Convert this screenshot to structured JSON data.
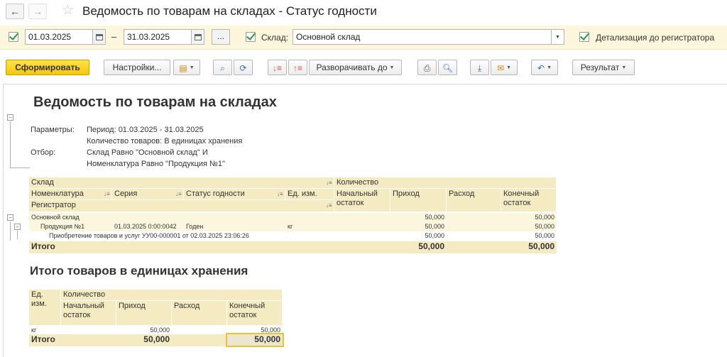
{
  "window": {
    "title": "Ведомость по товарам на складах - Статус годности",
    "back_glyph": "←",
    "forward_glyph": "→",
    "star_glyph": "☆"
  },
  "filter": {
    "date_from": "01.03.2025",
    "date_separator": "–",
    "date_to": "31.03.2025",
    "dots_label": "...",
    "warehouse_label": "Склад:",
    "warehouse_value": "Основной склад",
    "detail_label": "Детализация до регистратора",
    "dropdown_glyph": "▼"
  },
  "toolbar": {
    "generate_label": "Сформировать",
    "settings_label": "Настройки...",
    "expand_label": "Разворачивать до",
    "result_label": "Результат",
    "caret_glyph": "▼",
    "icons": [
      "save-variant-icon",
      "search-icon",
      "search-next-icon",
      "sort-asc-icon",
      "sort-desc-icon",
      "print-icon",
      "preview-icon",
      "download-icon",
      "mail-icon",
      "undo-icon"
    ]
  },
  "report": {
    "title": "Ведомость по товарам на складах",
    "params_label": "Параметры:",
    "params_line1": "Период: 01.03.2025 - 31.03.2025",
    "params_line2": "Количество товаров: В единицах хранения",
    "filter_label": "Отбор:",
    "filter_line1": "Склад Равно \"Основной склад\" И",
    "filter_line2": "Номенклатура Равно \"Продукция №1\"",
    "gutter_glyph": "−",
    "sort_glyph": "↓≡",
    "table1": {
      "h_warehouse": "Склад",
      "h_quantity": "Количество",
      "h_nomenclature": "Номенклатура",
      "h_series": "Серия",
      "h_status": "Статус годности",
      "h_unit": "Ед. изм.",
      "h_start_1": "Начальный",
      "h_start_2": "остаток",
      "h_income": "Приход",
      "h_outcome": "Расход",
      "h_end_1": "Конечный",
      "h_end_2": "остаток",
      "h_registrar": "Регистратор",
      "row_warehouse": {
        "name": "Основной склад",
        "income": "50,000",
        "end": "50,000"
      },
      "row_product": {
        "name": "Продукция №1",
        "series": "01.03.2025 0:00:0042",
        "status": "Годен",
        "unit": "кг",
        "income": "50,000",
        "end": "50,000"
      },
      "row_doc": {
        "name": "Приобретение товаров и услуг УУ00-000001 от 02.03.2025 23:06:26",
        "income": "50,000",
        "end": "50,000"
      },
      "total": {
        "label": "Итого",
        "income": "50,000",
        "end": "50,000"
      }
    },
    "table2_title": "Итого товаров в единицах хранения",
    "table2": {
      "h_unit_1": "Ед.",
      "h_unit_2": "изм.",
      "h_quantity": "Количество",
      "h_start_1": "Начальный",
      "h_start_2": "остаток",
      "h_income": "Приход",
      "h_outcome": "Расход",
      "h_end_1": "Конечный",
      "h_end_2": "остаток",
      "row": {
        "unit": "кг",
        "income": "50,000",
        "end": "50,000"
      },
      "total": {
        "label": "Итого",
        "income": "50,000",
        "end": "50,000"
      }
    }
  }
}
